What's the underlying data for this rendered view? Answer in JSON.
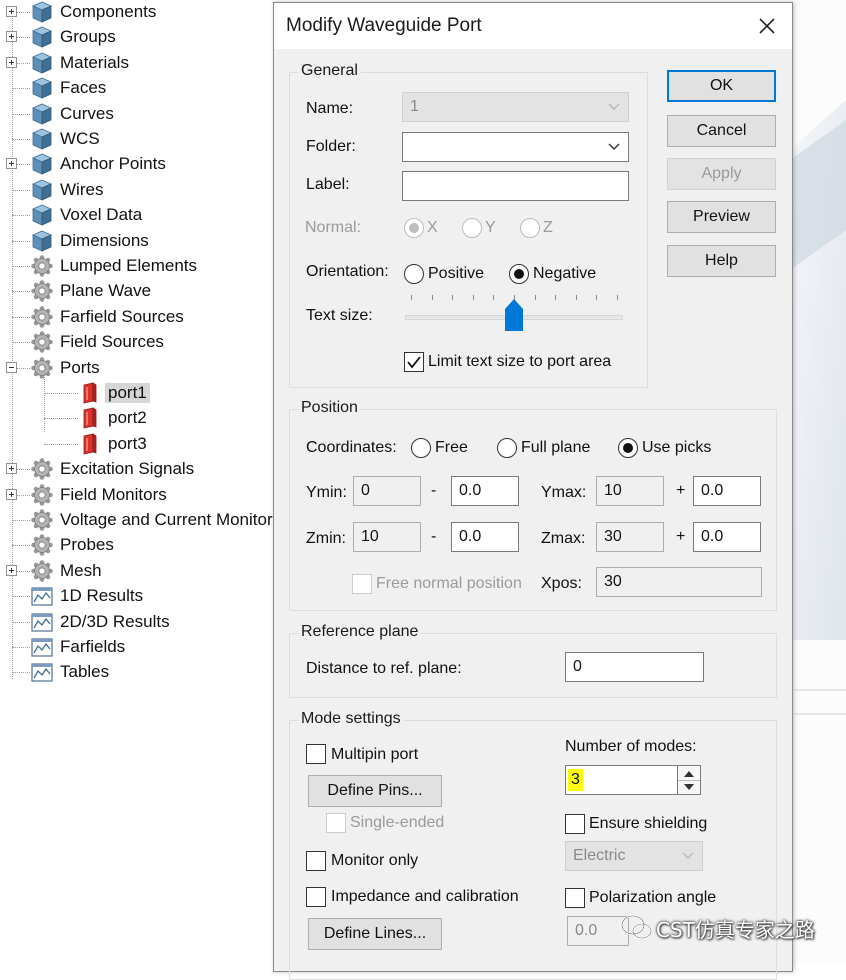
{
  "tree": {
    "items": [
      {
        "label": "Components",
        "icon": "cube-icon",
        "expander": "plus"
      },
      {
        "label": "Groups",
        "icon": "cube-icon",
        "expander": "plus"
      },
      {
        "label": "Materials",
        "icon": "cube-icon",
        "expander": "plus"
      },
      {
        "label": "Faces",
        "icon": "cube-icon",
        "expander": "none"
      },
      {
        "label": "Curves",
        "icon": "cube-icon",
        "expander": "none"
      },
      {
        "label": "WCS",
        "icon": "cube-icon",
        "expander": "none"
      },
      {
        "label": "Anchor Points",
        "icon": "cube-icon",
        "expander": "plus"
      },
      {
        "label": "Wires",
        "icon": "cube-icon",
        "expander": "none"
      },
      {
        "label": "Voxel Data",
        "icon": "cube-icon",
        "expander": "none"
      },
      {
        "label": "Dimensions",
        "icon": "cube-icon",
        "expander": "none"
      },
      {
        "label": "Lumped Elements",
        "icon": "gear-icon",
        "expander": "none"
      },
      {
        "label": "Plane Wave",
        "icon": "gear-icon",
        "expander": "none"
      },
      {
        "label": "Farfield Sources",
        "icon": "gear-icon",
        "expander": "none"
      },
      {
        "label": "Field Sources",
        "icon": "gear-icon",
        "expander": "none"
      },
      {
        "label": "Ports",
        "icon": "gear-icon",
        "expander": "minus"
      },
      {
        "label": "port1",
        "icon": "port-icon",
        "expander": "child",
        "selected": true
      },
      {
        "label": "port2",
        "icon": "port-icon",
        "expander": "child"
      },
      {
        "label": "port3",
        "icon": "port-icon",
        "expander": "child"
      },
      {
        "label": "Excitation Signals",
        "icon": "gear-icon",
        "expander": "plus"
      },
      {
        "label": "Field Monitors",
        "icon": "gear-icon",
        "expander": "plus"
      },
      {
        "label": "Voltage and Current Monitors",
        "icon": "gear-icon",
        "expander": "none"
      },
      {
        "label": "Probes",
        "icon": "gear-icon",
        "expander": "none"
      },
      {
        "label": "Mesh",
        "icon": "gear-icon",
        "expander": "plus"
      },
      {
        "label": "1D Results",
        "icon": "chart-icon",
        "expander": "none"
      },
      {
        "label": "2D/3D Results",
        "icon": "chart-icon",
        "expander": "none"
      },
      {
        "label": "Farfields",
        "icon": "chart-icon",
        "expander": "none"
      },
      {
        "label": "Tables",
        "icon": "chart-icon",
        "expander": "none"
      }
    ]
  },
  "dialog": {
    "title": "Modify Waveguide Port",
    "buttons": {
      "ok": "OK",
      "cancel": "Cancel",
      "apply": "Apply",
      "preview": "Preview",
      "help": "Help"
    },
    "general": {
      "title": "General",
      "name_label": "Name:",
      "name_value": "1",
      "folder_label": "Folder:",
      "folder_value": "",
      "label_label": "Label:",
      "label_value": "",
      "normal_label": "Normal:",
      "normal_x": "X",
      "normal_y": "Y",
      "normal_z": "Z",
      "orientation_label": "Orientation:",
      "orientation_positive": "Positive",
      "orientation_negative": "Negative",
      "text_size_label": "Text size:",
      "text_size_fraction": 0.5,
      "limit_text_label": "Limit text size to port area"
    },
    "position": {
      "title": "Position",
      "coordinates_label": "Coordinates:",
      "free": "Free",
      "full_plane": "Full plane",
      "use_picks": "Use picks",
      "ymin_label": "Ymin:",
      "ymin": "0",
      "ymin_offset": "0.0",
      "ymax_label": "Ymax:",
      "ymax": "10",
      "ymax_offset": "0.0",
      "zmin_label": "Zmin:",
      "zmin": "10",
      "zmin_offset": "0.0",
      "zmax_label": "Zmax:",
      "zmax": "30",
      "zmax_offset": "0.0",
      "minus": "-",
      "plus": "+",
      "free_normal_label": "Free normal position",
      "xpos_label": "Xpos:",
      "xpos": "30"
    },
    "reference": {
      "title": "Reference plane",
      "distance_label": "Distance to ref. plane:",
      "distance_value": "0"
    },
    "mode": {
      "title": "Mode settings",
      "multipin_label": "Multipin port",
      "define_pins": "Define Pins...",
      "single_ended": "Single-ended",
      "monitor_only": "Monitor only",
      "impedance_label": "Impedance and calibration",
      "define_lines": "Define Lines...",
      "num_modes_label": "Number of modes:",
      "num_modes_value": "3",
      "ensure_shielding": "Ensure shielding",
      "shielding_type": "Electric",
      "polarization_label": "Polarization angle",
      "polarization_value": "0.0"
    }
  },
  "watermark": {
    "text": "CST仿真专家之路"
  },
  "colors": {
    "accent": "#0078d7",
    "highlight": "#ffff00",
    "port_red": "#d9332b",
    "cube_blue": "#5b8fb8"
  }
}
